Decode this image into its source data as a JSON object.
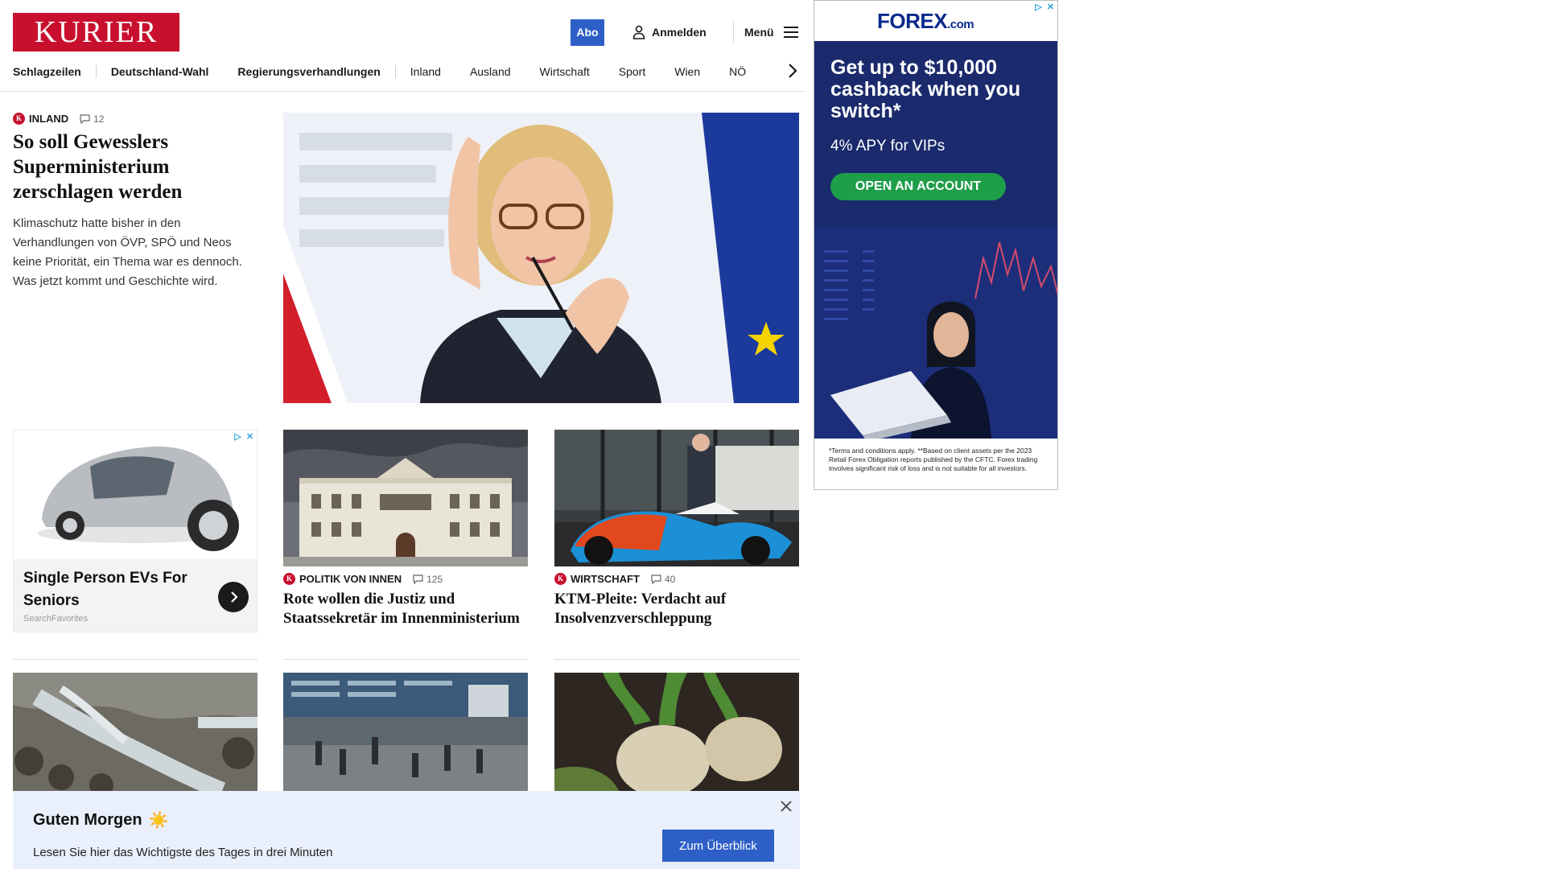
{
  "header": {
    "logo": "KURIER",
    "abo_label": "Abo",
    "login_label": "Anmelden",
    "menu_label": "Menü"
  },
  "nav": {
    "items": [
      "Schlagzeilen",
      "Deutschland-Wahl",
      "Regierungsverhandlungen",
      "Inland",
      "Ausland",
      "Wirtschaft",
      "Sport",
      "Wien",
      "NÖ"
    ]
  },
  "hero": {
    "category": "INLAND",
    "comments": "12",
    "title": "So soll Gewesslers Superministerium zerschlagen werden",
    "description": "Klimaschutz hatte bisher in den Verhandlungen von ÖVP, SPÖ und Neos keine Priorität, ein Thema war es dennoch. Was jetzt kommt und Geschichte wird."
  },
  "ad_card": {
    "title": "Single Person EVs For Seniors",
    "source": "SearchFavorites"
  },
  "articles": [
    {
      "category": "POLITIK VON INNEN",
      "comments": "125",
      "title": "Rote wollen die Justiz und Staatssekretär im Innenministerium"
    },
    {
      "category": "WIRTSCHAFT",
      "comments": "40",
      "title": "KTM-Pleite: Verdacht auf Insolvenzverschleppung"
    }
  ],
  "side_ad": {
    "logo": "FOREX",
    "logo_suffix": ".com",
    "headline": "Get up to $10,000 cashback when you switch*",
    "subline": "4% APY for VIPs",
    "button": "OPEN AN ACCOUNT",
    "disclaimer": "*Terms and conditions apply. **Based on client assets per the 2023 Retail Forex Obligation reports published by the CFTC. Forex trading involves significant risk of loss and is not suitable for all investors."
  },
  "banner": {
    "title": "Guten Morgen",
    "emoji": "☀️",
    "description": "Lesen Sie hier das Wichtigste des Tages in drei Minuten",
    "button": "Zum Überblick"
  },
  "colors": {
    "brand_red": "#c8102e",
    "accent_blue": "#2d5fc7",
    "forex_navy": "#1a2a6c",
    "forex_green": "#1f9e4a",
    "banner_bg": "#eaf0fb"
  }
}
